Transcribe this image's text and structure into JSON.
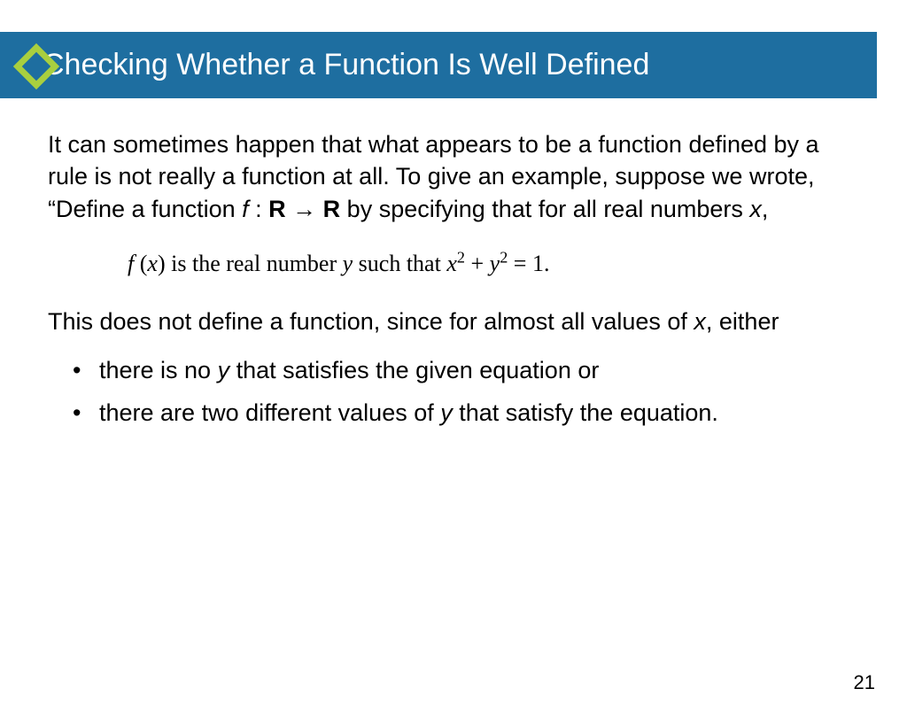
{
  "title": "Checking Whether a Function Is Well Defined",
  "para1_a": "It can sometimes happen that what appears to be a function defined by a rule is not really a function at all. To give an example, suppose we wrote, “Define a function ",
  "para1_f": "f",
  "para1_colon": " : ",
  "para1_R1": "R",
  "para1_arrow": " → ",
  "para1_R2": "R",
  "para1_b": " by specifying that for all real numbers ",
  "para1_x": "x",
  "para1_c": ",",
  "eq_fx_f": "f ",
  "eq_fx_open": "(",
  "eq_fx_x": "x",
  "eq_fx_close": ")",
  "eq_mid": " is the real number ",
  "eq_y": "y",
  "eq_such": " such that ",
  "eq_x2": "x",
  "eq_sup2a": "2",
  "eq_plus": " + ",
  "eq_y2": "y",
  "eq_sup2b": "2",
  "eq_eq1": " = 1.",
  "para2_a": "This does not define a function, since for almost all values of ",
  "para2_x": "x",
  "para2_b": ", either",
  "bullet1_a": "there is no ",
  "bullet1_y": "y",
  "bullet1_b": " that satisfies the given equation or",
  "bullet2_a": "there are two different values of ",
  "bullet2_y": "y",
  "bullet2_b": " that satisfy the equation.",
  "page_number": "21"
}
